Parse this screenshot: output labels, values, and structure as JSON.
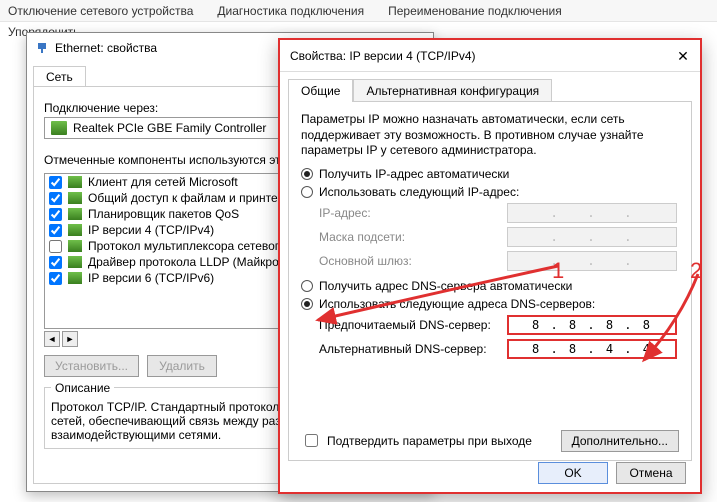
{
  "toolbar": {
    "disable_device": "Отключение сетевого устройства",
    "diagnose": "Диагностика подключения",
    "rename": "Переименование подключения",
    "organize": "Упорядочить"
  },
  "win1": {
    "title": "Ethernet: свойства",
    "tab": "Сеть",
    "connect_via": "Подключение через:",
    "adapter": "Realtek PCIe GBE Family Controller",
    "components_label": "Отмеченные компоненты используются этим",
    "items": [
      {
        "checked": true,
        "label": "Клиент для сетей Microsoft"
      },
      {
        "checked": true,
        "label": "Общий доступ к файлам и принтерам"
      },
      {
        "checked": true,
        "label": "Планировщик пакетов QoS"
      },
      {
        "checked": true,
        "label": "IP версии 4 (TCP/IPv4)"
      },
      {
        "checked": false,
        "label": "Протокол мультиплексора сетевого"
      },
      {
        "checked": true,
        "label": "Драйвер протокола LLDP (Майкрос"
      },
      {
        "checked": true,
        "label": "IP версии 6 (TCP/IPv6)"
      }
    ],
    "install": "Установить...",
    "uninstall": "Удалить",
    "desc_title": "Описание",
    "desc": "Протокол TCP/IP. Стандартный протокол глобальных сетей, обеспечивающий связь между различными взаимодействующими сетями."
  },
  "win2": {
    "title": "Свойства: IP версии 4 (TCP/IPv4)",
    "tab_general": "Общие",
    "tab_alt": "Альтернативная конфигурация",
    "para": "Параметры IP можно назначать автоматически, если сеть поддерживает эту возможность. В противном случае узнайте параметры IP у сетевого администратора.",
    "r_ip_auto": "Получить IP-адрес автоматически",
    "r_ip_manual": "Использовать следующий IP-адрес:",
    "ip_addr": "IP-адрес:",
    "mask": "Маска подсети:",
    "gateway": "Основной шлюз:",
    "r_dns_auto": "Получить адрес DNS-сервера автоматически",
    "r_dns_manual": "Использовать следующие адреса DNS-серверов:",
    "dns_pref": "Предпочитаемый DNS-сервер:",
    "dns_alt": "Альтернативный DNS-сервер:",
    "dns_pref_val": "8 . 8 . 8 . 8",
    "dns_alt_val": "8 . 8 . 4 . 4",
    "validate": "Подтвердить параметры при выходе",
    "advanced": "Дополнительно...",
    "ok": "OK",
    "cancel": "Отмена"
  },
  "annotations": {
    "one": "1",
    "two": "2"
  }
}
